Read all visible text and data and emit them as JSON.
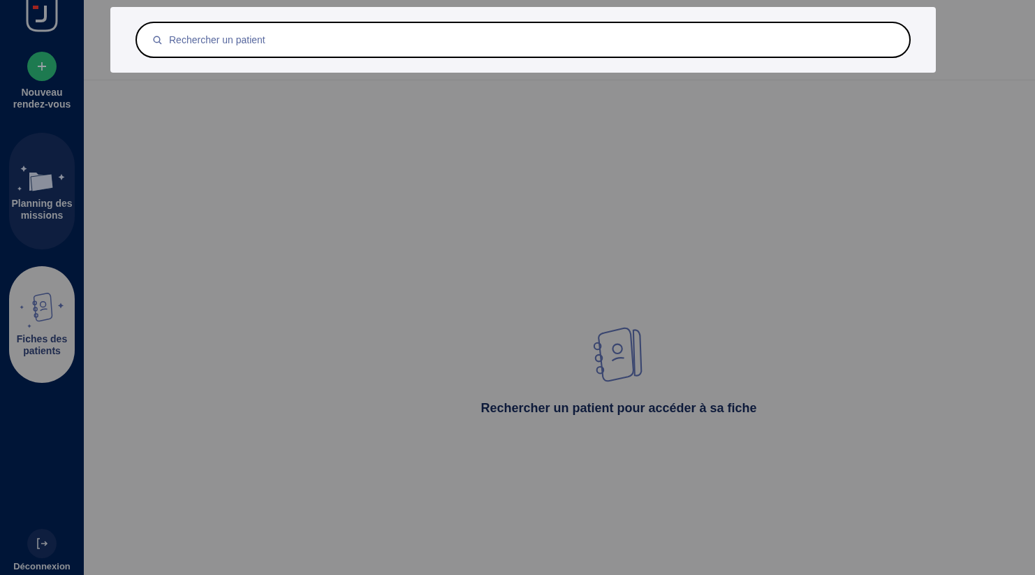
{
  "sidebar": {
    "items": [
      {
        "kind": "action",
        "label": "Nouveau rendez-vous",
        "selected": false
      },
      {
        "kind": "nav",
        "label": "Planning des missions",
        "selected": false
      },
      {
        "kind": "nav",
        "label": "Fiches des patients",
        "selected": true
      }
    ],
    "logout": {
      "label": "Déconnexion"
    }
  },
  "search": {
    "placeholder": "Rechercher un patient"
  },
  "empty_state": {
    "message": "Rechercher un patient pour accéder à sa fiche"
  }
}
